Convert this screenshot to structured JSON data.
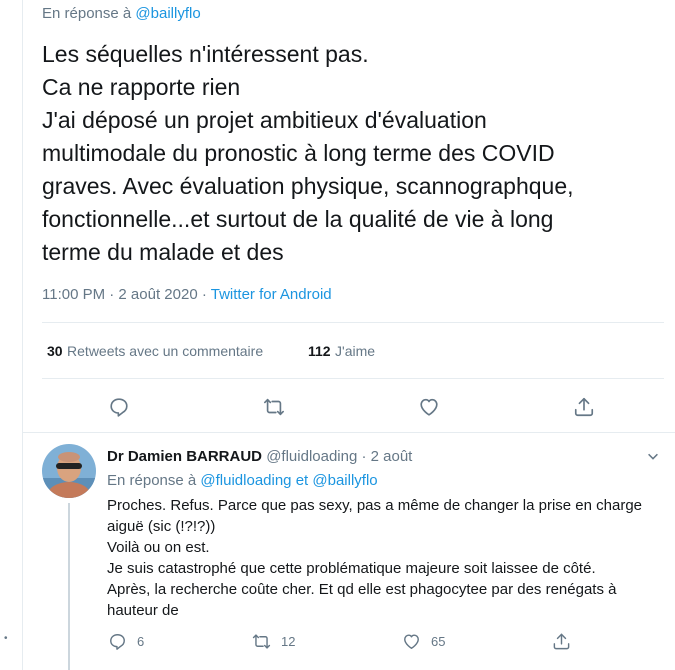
{
  "tweet": {
    "context_prefix": "En réponse à",
    "context_handle": "@baillyflo",
    "lines": [
      "Les séquelles n'intéressent pas.",
      "Ca ne rapporte rien",
      "J'ai déposé un projet ambitieux d'évaluation",
      "multimodale du pronostic à long terme des COVID",
      "graves. Avec évaluation physique, scannographque,",
      "fonctionnelle...et surtout de la qualité de vie à long",
      "terme du malade et des"
    ],
    "timestamp": "11:00 PM · 2 août 2020 · ",
    "source": "Twitter for Android",
    "retweets_count": "30",
    "retweets_label": "Retweets avec un commentaire",
    "likes_count": "112",
    "likes_label": "J'aime"
  },
  "reply": {
    "name": "Dr Damien BARRAUD",
    "handle_date": " @fluidloading · 2 août",
    "context_prefix": "En réponse à ",
    "context_handle_1": "@fluidloading",
    "context_and": " et ",
    "context_handle_2": "@baillyflo",
    "lines": [
      "Proches. Refus. Parce que pas sexy, pas a même de changer la prise en charge",
      "aiguë (sic (!?!?))",
      "Voilà ou on est.",
      "Je suis catastrophé que cette problématique majeure soit laissee de côté.",
      "Après, la recherche coûte cher. Et qd elle est phagocytee par des renégats à",
      "hauteur de"
    ],
    "reply_count": "6",
    "retweet_count": "12",
    "like_count": "65"
  },
  "misc": {
    "stray_mark": "•"
  },
  "colors": {
    "accent": "#1b95e0",
    "muted": "#657786",
    "text": "#14171a",
    "border": "#e6ecf0"
  },
  "icons": [
    "reply-icon",
    "retweet-icon",
    "like-icon",
    "share-icon",
    "chevron-down-icon"
  ]
}
